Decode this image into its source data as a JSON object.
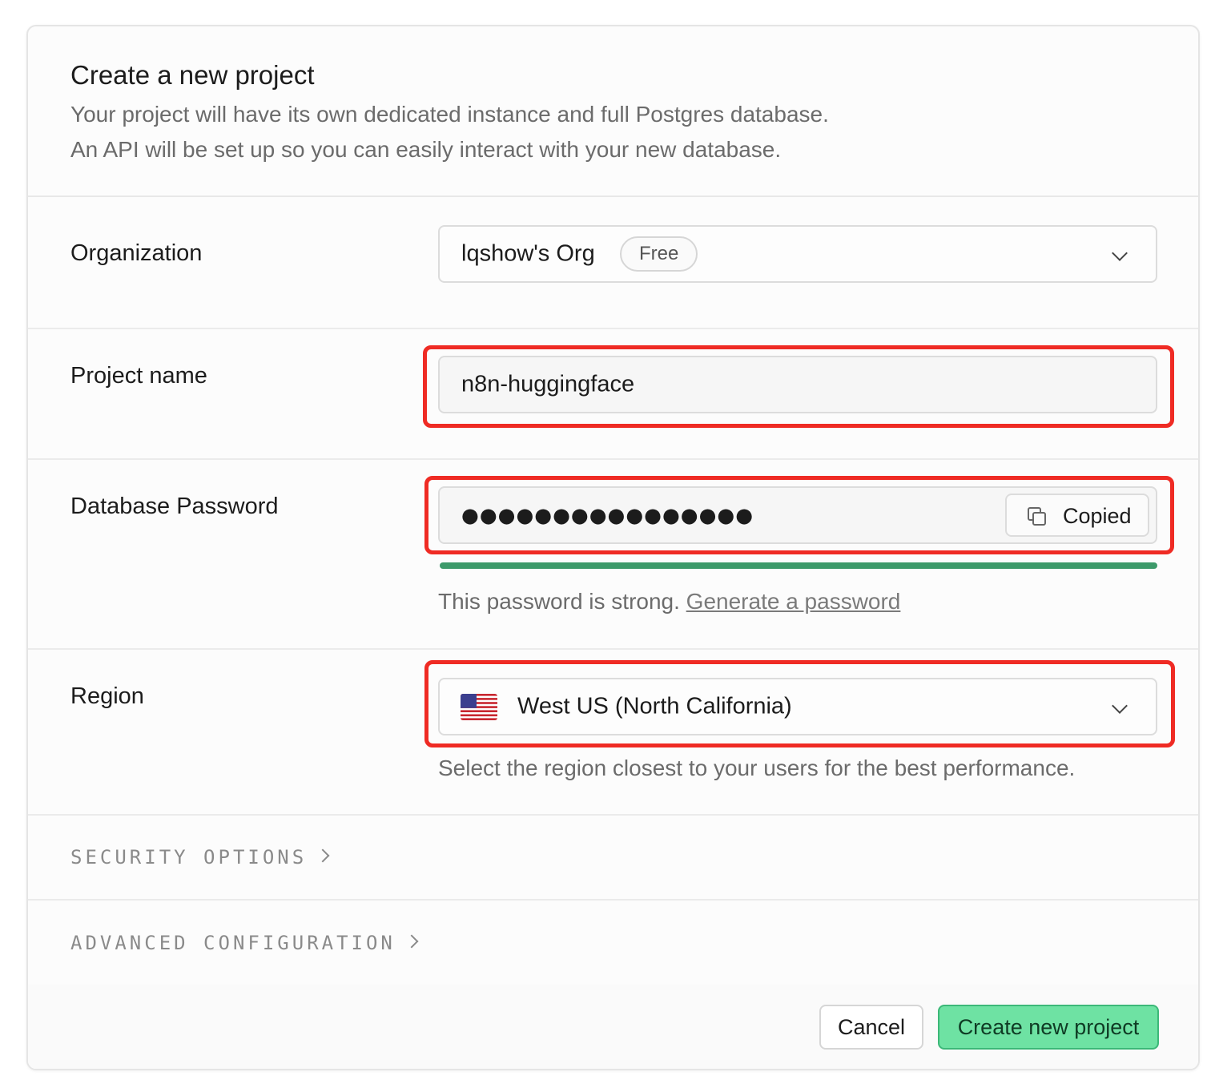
{
  "header": {
    "title": "Create a new project",
    "description_line1": "Your project will have its own dedicated instance and full Postgres database.",
    "description_line2": "An API will be set up so you can easily interact with your new database."
  },
  "organization": {
    "label": "Organization",
    "value": "lqshow's Org",
    "plan_badge": "Free",
    "icon": "chevron-down-icon"
  },
  "project_name": {
    "label": "Project name",
    "value": "n8n-huggingface"
  },
  "database_password": {
    "label": "Database Password",
    "masked_value": "●●●●●●●●●●●●●●●●",
    "copy_button_label": "Copied",
    "copy_icon": "copy-icon",
    "strength_percent": 100,
    "strength_color": "#3d9a6a",
    "strength_text": "This password is strong.",
    "generate_link": "Generate a password"
  },
  "region": {
    "label": "Region",
    "value": "West US (North California)",
    "flag_icon": "us-flag-icon",
    "help_text": "Select the region closest to your users for the best performance."
  },
  "sections": {
    "security": "SECURITY OPTIONS",
    "advanced": "ADVANCED CONFIGURATION"
  },
  "footer": {
    "cancel_label": "Cancel",
    "create_label": "Create new project",
    "create_color": "#6ee2a3"
  },
  "annotation_color": "#ef2b24"
}
